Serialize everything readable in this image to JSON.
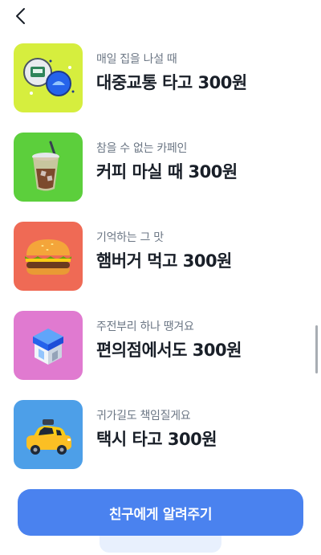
{
  "items": [
    {
      "subtitle": "매일 집을 나설 때",
      "title": "대중교통 타고 300원",
      "icon": "transit-card-icon",
      "bg": "#d6ee3e"
    },
    {
      "subtitle": "참을 수 없는 카페인",
      "title": "커피 마실 때 300원",
      "icon": "iced-coffee-icon",
      "bg": "#5ccf3c"
    },
    {
      "subtitle": "기억하는 그 맛",
      "title": "햄버거 먹고 300원",
      "icon": "hamburger-icon",
      "bg": "#ef6a55"
    },
    {
      "subtitle": "주전부리 하나 땡겨요",
      "title": "편의점에서도 300원",
      "icon": "convenience-store-icon",
      "bg": "#e07ad0"
    },
    {
      "subtitle": "귀가길도 책임질게요",
      "title": "택시 타고 300원",
      "icon": "taxi-icon",
      "bg": "#4d9fe8"
    }
  ],
  "cta": {
    "label": "친구에게 알려주기"
  }
}
